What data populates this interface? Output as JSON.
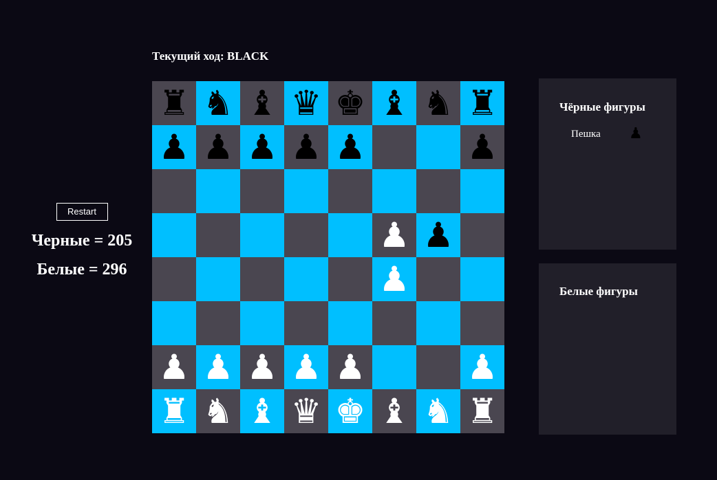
{
  "turn_label": "Текущий ход: BLACK",
  "restart_label": "Restart",
  "scores": {
    "black": "Черные = 205",
    "white": "Белые = 296"
  },
  "colors": {
    "background": "#0b0914",
    "dark_square": "#4a4650",
    "light_square": "#00bfff",
    "panel": "#211f29",
    "black_piece": "#000000",
    "white_piece": "#ffffff"
  },
  "board": [
    [
      "bR",
      "bN",
      "bB",
      "bQ",
      "bK",
      "bB",
      "bN",
      "bR"
    ],
    [
      "bP",
      "bP",
      "bP",
      "bP",
      "bP",
      "",
      "",
      "bP"
    ],
    [
      "",
      "",
      "",
      "",
      "",
      "",
      "",
      ""
    ],
    [
      "",
      "",
      "",
      "",
      "",
      "wP",
      "bP",
      ""
    ],
    [
      "",
      "",
      "",
      "",
      "",
      "wP",
      "",
      ""
    ],
    [
      "",
      "",
      "",
      "",
      "",
      "",
      "",
      ""
    ],
    [
      "wP",
      "wP",
      "wP",
      "wP",
      "wP",
      "",
      "",
      "wP"
    ],
    [
      "wR",
      "wN",
      "wB",
      "wQ",
      "wK",
      "wB",
      "wN",
      "wR"
    ]
  ],
  "captured": {
    "black_title": "Чёрные фигуры",
    "black_items": [
      {
        "name": "Пешка",
        "icon": "black-pawn-icon"
      }
    ],
    "white_title": "Белые фигуры",
    "white_items": []
  }
}
